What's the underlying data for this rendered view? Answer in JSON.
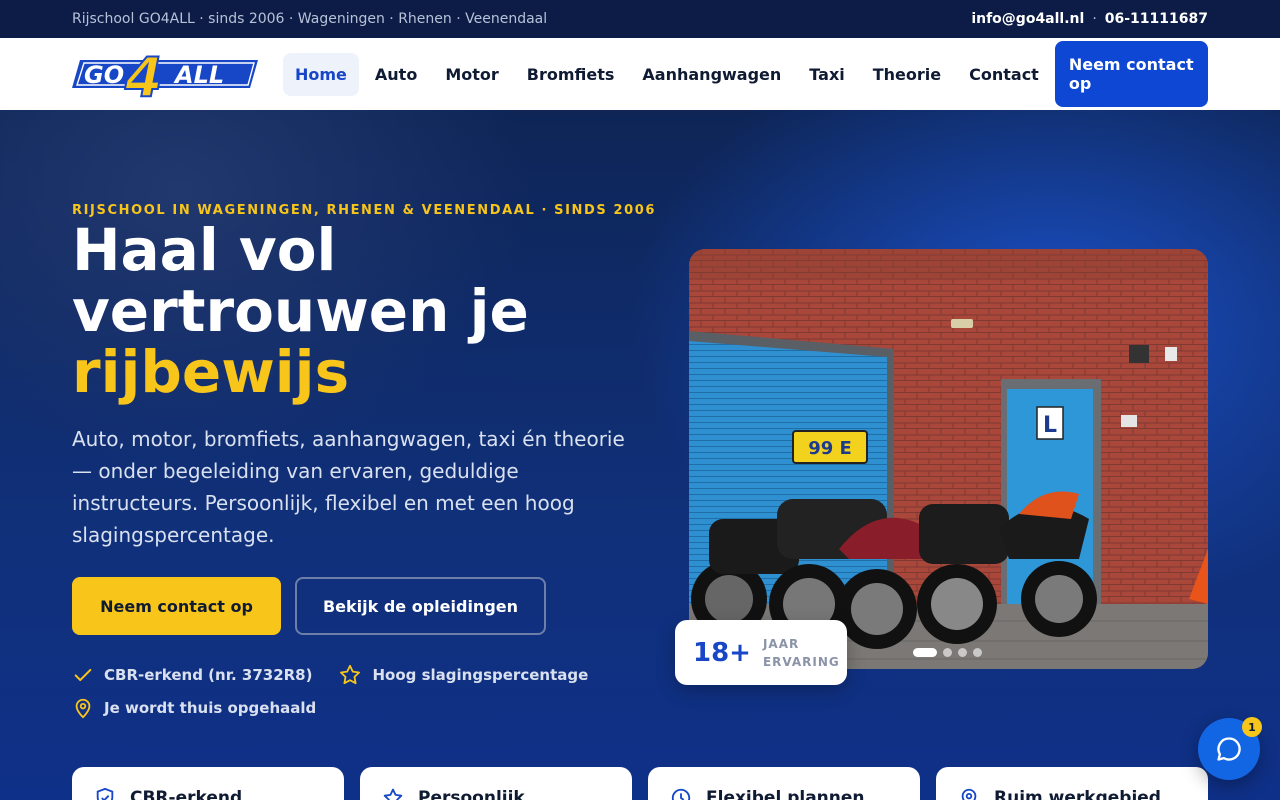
{
  "topbar": {
    "tagline": "Rijschool GO4ALL · sinds 2006 · Wageningen · Rhenen · Veenendaal",
    "email": "info@go4all.nl",
    "separator": "·",
    "phone": "06-11111687"
  },
  "logo": {
    "text_left": "GO",
    "text_mid": "4",
    "text_right": "ALL"
  },
  "nav": {
    "items": [
      {
        "label": "Home",
        "active": true
      },
      {
        "label": "Auto"
      },
      {
        "label": "Motor"
      },
      {
        "label": "Bromfiets"
      },
      {
        "label": "Aanhangwagen"
      },
      {
        "label": "Taxi"
      },
      {
        "label": "Theorie"
      },
      {
        "label": "Contact"
      }
    ],
    "cta": "Neem contact op"
  },
  "hero": {
    "eyebrow": "RIJSCHOOL IN WAGENINGEN, RHENEN & VEENENDAAL · SINDS 2006",
    "headline_line1": "Haal vol",
    "headline_line2": "vertrouwen je",
    "headline_accent": "rijbewijs",
    "lead": "Auto, motor, bromfiets, aanhangwagen, taxi én theorie — onder begeleiding van ervaren, geduldige instructeurs. Persoonlijk, flexibel en met een hoog slagingspercentage.",
    "primary_button": "Neem contact op",
    "secondary_button": "Bekijk de opleidingen",
    "badges": [
      {
        "icon": "check-icon",
        "label": "CBR-erkend (nr. 3732R8)"
      },
      {
        "icon": "star-icon",
        "label": "Hoog slagingspercentage"
      },
      {
        "icon": "map-pin-icon",
        "label": "Je wordt thuis opgehaald"
      }
    ],
    "stat": {
      "number": "18+",
      "label": "JAAR ERVARING"
    },
    "photo": {
      "garage_number": "99 E",
      "door_sign": "L"
    },
    "carousel": {
      "slides": 4,
      "active_index": 0
    }
  },
  "features": [
    {
      "icon": "shield-check-icon",
      "label": "CBR-erkend"
    },
    {
      "icon": "star-icon",
      "label": "Persoonlijk"
    },
    {
      "icon": "clock-icon",
      "label": "Flexibel plannen"
    },
    {
      "icon": "map-pin-icon",
      "label": "Ruim werkgebied"
    }
  ],
  "chat": {
    "icon": "chat-bubble-icon",
    "unread": "1"
  },
  "colors": {
    "accent": "#f8c51a",
    "brand": "#0d47d4",
    "navy": "#0c1c46"
  }
}
